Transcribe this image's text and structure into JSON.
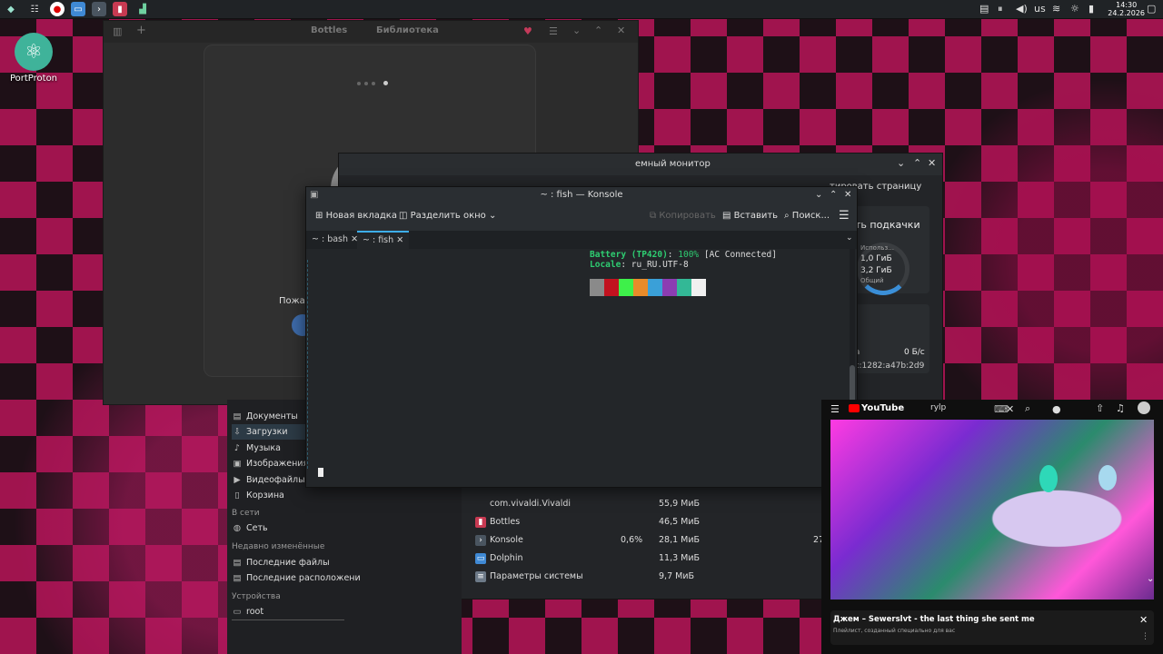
{
  "taskbar": {
    "tray_lang": "us",
    "clock_time": "14:30",
    "clock_date": "24.2.2026"
  },
  "desktop": {
    "icon_label": "PortProton"
  },
  "bottles": {
    "tab_bottles": "Bottles",
    "tab_library": "Библиотека",
    "welcome_fragment": "Пожал"
  },
  "sysmon": {
    "title": "емный монитор",
    "copy_page": "тировать страницу",
    "swap_title": "ть подкачки",
    "swap_used_label": "Использ...",
    "swap_used": "1,0 ГиБ",
    "swap_total": "3,2 ГиБ",
    "swap_common": "Общий",
    "net_label": "на",
    "net_rate": "0 Б/с",
    "net_addr": "ac:1282:a47b:2d9",
    "processes": [
      {
        "name": "com.vivaldi.Vivaldi",
        "cpu": "",
        "mem": "55,9 МиБ",
        "extra": "",
        "icon": "generic"
      },
      {
        "name": "Bottles",
        "cpu": "",
        "mem": "46,5 МиБ",
        "extra": "",
        "icon": "bottles"
      },
      {
        "name": "Konsole",
        "cpu": "0,6%",
        "mem": "28,1 МиБ",
        "extra": "27",
        "icon": "terminal"
      },
      {
        "name": "Dolphin",
        "cpu": "",
        "mem": "11,3 МиБ",
        "extra": "",
        "icon": "folder"
      },
      {
        "name": "Параметры системы",
        "cpu": "",
        "mem": "9,7 МиБ",
        "extra": "",
        "icon": "settings"
      }
    ]
  },
  "dolphin": {
    "places": [
      {
        "label": "Документы",
        "icon": "document"
      },
      {
        "label": "Загрузки",
        "icon": "download"
      },
      {
        "label": "Музыка",
        "icon": "music"
      },
      {
        "label": "Изображения",
        "icon": "image"
      },
      {
        "label": "Видеофайлы",
        "icon": "video"
      },
      {
        "label": "Корзина",
        "icon": "trash"
      }
    ],
    "section_network": "В сети",
    "network_item": "Сеть",
    "section_recent": "Недавно изменённые",
    "recent_files": "Последние файлы",
    "recent_locations": "Последние расположени",
    "section_devices": "Устройства",
    "device_root": "root"
  },
  "konsole": {
    "title": "~ : fish — Konsole",
    "new_tab": "Новая вкладка",
    "split": "Разделить окно",
    "copy": "Копировать",
    "paste": "Вставить",
    "search": "Поиск...",
    "tabs": [
      {
        "label": "~ : bash",
        "active": false
      },
      {
        "label": "~ : fish",
        "active": true
      }
    ],
    "line1_key": "Battery (TP420)",
    "line1_pct": "100%",
    "line1_rest": "[AC Connected]",
    "line2_key": "Locale",
    "line2_val": "ru_RU.UTF-8",
    "palette": [
      "#8a8a8a",
      "#c2121f",
      "#3ef04a",
      "#e88b2a",
      "#3aa0d8",
      "#8c3db2",
      "#33b896",
      "#f0f0f0"
    ]
  },
  "youtube": {
    "logo": "YouTube",
    "search_value": "rylp",
    "video_title": "Джем – Sewerslvt - the last thing she sent me",
    "video_sub": "Плейлист, созданный специально для вас"
  }
}
